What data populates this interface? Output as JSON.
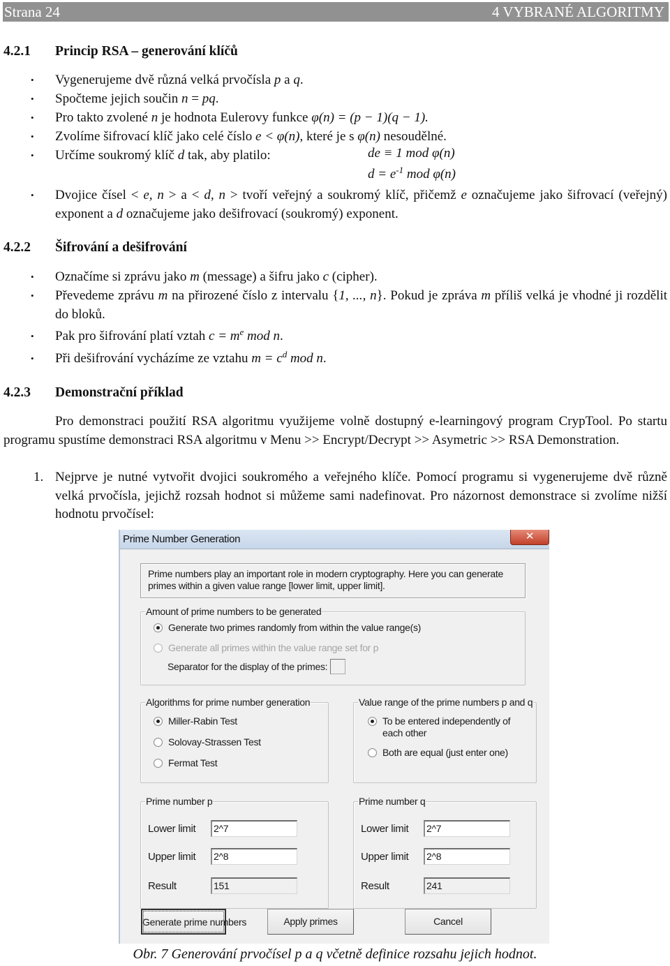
{
  "header": {
    "page_label": "Strana 24",
    "chapter_title": "4 VYBRANÉ ALGORITMY"
  },
  "sections": [
    {
      "number": "4.2.1",
      "title": "Princip RSA – generování klíčů",
      "bullets": [
        "Vygenerujeme dvě různá velká prvočísla p a q.",
        "Spočteme jejich součin n = pq.",
        "Pro takto zvolené n je hodnota Eulerovy funkce φ(n) = (p − 1)(q − 1).",
        "Zvolíme šifrovací klíč jako celé číslo e < φ(n), které je s φ(n) nesoudělné.",
        "Určíme soukromý klíč d tak, aby platilo:",
        "Dvojice čísel < e, n > a < d, n > tvoří veřejný a soukromý klíč, přičemž e označujeme jako šifrovací (veřejný) exponent a d označujeme jako dešifrovací (soukromý) exponent."
      ],
      "formulas": [
        "de ≡ 1 mod φ(n)",
        "d = e-1 mod φ(n)"
      ]
    },
    {
      "number": "4.2.2",
      "title": "Šifrování a dešifrování",
      "bullets": [
        "Označíme si zprávu jako m (message) a šifru jako c (cipher).",
        "Převedeme zprávu m na přirozené číslo z intervalu {1, ..., n}. Pokud je zpráva m příliš velká je vhodné ji rozdělit do bloků.",
        "Pak pro šifrování platí vztah c = me mod n.",
        "Při dešifrování vycházíme ze vztahu m = cd mod n."
      ]
    },
    {
      "number": "4.2.3",
      "title": "Demonstrační příklad",
      "paragraph": "Pro demonstraci použití RSA algoritmu využijeme volně dostupný e-learningový program CrypTool. Po startu programu spustíme demonstraci RSA algoritmu v Menu >> Encrypt/Decrypt >> Asymetric >> RSA Demonstration.",
      "numbered": [
        {
          "n": "1.",
          "text": "Nejprve je nutné vytvořit dvojici soukromého a veřejného klíče. Pomocí programu si vygenerujeme dvě různě velká prvočísla, jejichž rozsah hodnot si můžeme sami nadefinovat. Pro názornost demonstrace si zvolíme nižší hodnotu prvočísel:"
        }
      ]
    }
  ],
  "dialog": {
    "title": "Prime Number Generation",
    "close_icon": "close-x-icon",
    "info": "Prime numbers play an important role in modern cryptography. Here you can generate primes within a given value range [lower limit, upper limit].",
    "amount_group": {
      "title": "Amount of prime numbers to be generated",
      "options": [
        {
          "label": "Generate two primes randomly from within the value range(s)",
          "selected": true,
          "enabled": true
        },
        {
          "label": "Generate all primes within the value range set for p",
          "selected": false,
          "enabled": false
        }
      ],
      "separator_label": "Separator for the display of the primes:",
      "separator_value": ""
    },
    "algorithm_group": {
      "title": "Algorithms for prime number generation",
      "options": [
        {
          "label": "Miller-Rabin Test",
          "selected": true
        },
        {
          "label": "Solovay-Strassen Test",
          "selected": false
        },
        {
          "label": "Fermat Test",
          "selected": false
        }
      ]
    },
    "range_group": {
      "title": "Value range of the prime numbers p and q",
      "options": [
        {
          "label": "To be entered independently of each other",
          "selected": true
        },
        {
          "label": "Both are equal (just enter one)",
          "selected": false
        }
      ]
    },
    "prime_p": {
      "title": "Prime number p",
      "lower_label": "Lower limit",
      "lower_value": "2^7",
      "upper_label": "Upper limit",
      "upper_value": "2^8",
      "result_label": "Result",
      "result_value": "151"
    },
    "prime_q": {
      "title": "Prime number q",
      "lower_label": "Lower limit",
      "lower_value": "2^7",
      "upper_label": "Upper limit",
      "upper_value": "2^8",
      "result_label": "Result",
      "result_value": "241"
    },
    "buttons": {
      "generate": "Generate prime numbers",
      "apply": "Apply primes",
      "cancel": "Cancel"
    }
  },
  "caption": "Obr. 7 Generování prvočísel p a q včetně definice rozsahu jejich hodnot."
}
